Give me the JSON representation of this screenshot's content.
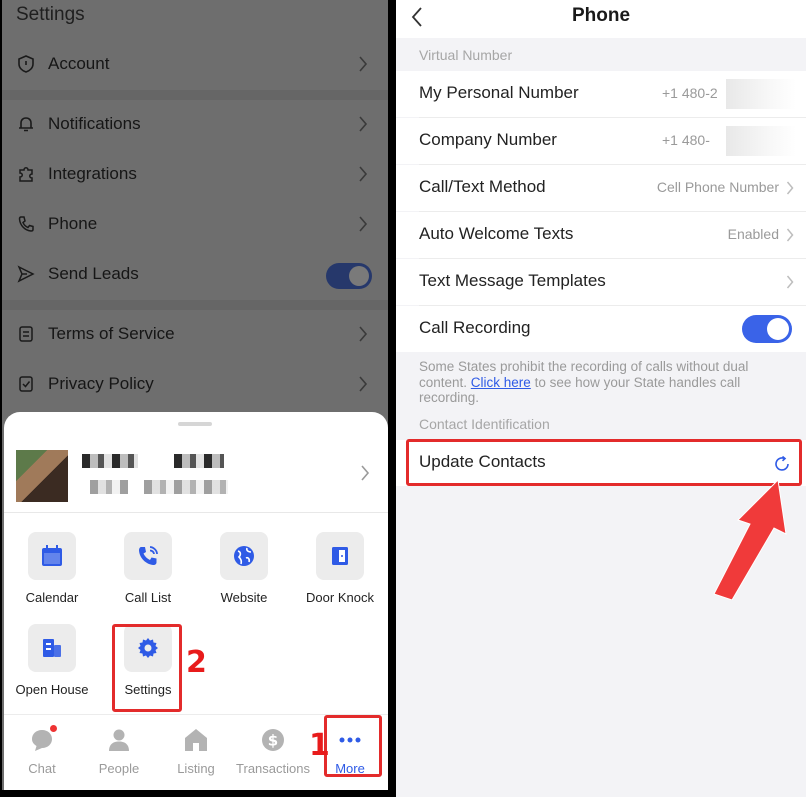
{
  "left": {
    "settings_title": "Settings",
    "settings_items": [
      {
        "label": "Account",
        "icon": "shield-icon"
      },
      {
        "label": "Notifications",
        "icon": "bell-icon"
      },
      {
        "label": "Integrations",
        "icon": "puzzle-icon"
      },
      {
        "label": "Phone",
        "icon": "phone-icon"
      },
      {
        "label": "Send Leads",
        "icon": "send-icon",
        "toggle": true
      },
      {
        "label": "Terms of Service",
        "icon": "document-icon"
      },
      {
        "label": "Privacy Policy",
        "icon": "checklist-icon"
      }
    ],
    "tiles": [
      {
        "label": "Calendar",
        "icon": "calendar-icon"
      },
      {
        "label": "Call List",
        "icon": "phone-call-icon"
      },
      {
        "label": "Website",
        "icon": "globe-icon"
      },
      {
        "label": "Door Knock",
        "icon": "door-icon"
      },
      {
        "label": "Open House",
        "icon": "building-icon"
      },
      {
        "label": "Settings",
        "icon": "gear-icon"
      }
    ],
    "tabs": [
      {
        "label": "Chat",
        "icon": "chat-icon"
      },
      {
        "label": "People",
        "icon": "person-icon"
      },
      {
        "label": "Listing",
        "icon": "house-icon"
      },
      {
        "label": "Transactions",
        "icon": "dollar-icon"
      },
      {
        "label": "More",
        "icon": "more-icon",
        "active": true
      }
    ],
    "step_labels": {
      "more": "1",
      "settings": "2"
    }
  },
  "right": {
    "title": "Phone",
    "section_virtual": "Virtual Number",
    "rows": [
      {
        "label": "My Personal Number",
        "value": "+1 480-2"
      },
      {
        "label": "Company Number",
        "value": "+1 480-"
      },
      {
        "label": "Call/Text Method",
        "value": "Cell Phone Number"
      },
      {
        "label": "Auto Welcome Texts",
        "value": "Enabled"
      },
      {
        "label": "Text Message Templates",
        "value": ""
      },
      {
        "label": "Call Recording",
        "value": ""
      }
    ],
    "note_before": "Some States prohibit the recording of calls without dual content. ",
    "note_link": "Click here",
    "note_after": " to see how your State handles call recording.",
    "section_contact": "Contact Identification",
    "update_contacts": "Update Contacts"
  },
  "colors": {
    "accent": "#2f5be6",
    "callout": "#e32b2b",
    "sheet_bg": "#ffffff",
    "overlay_bg": "#6e6e6e"
  }
}
